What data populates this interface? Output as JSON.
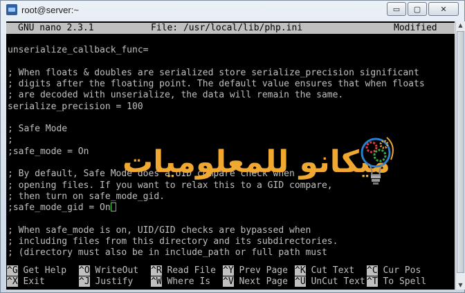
{
  "window": {
    "title": "root@server:~",
    "buttons": {
      "minimize": "▭",
      "maximize": "▢",
      "close": "✕"
    }
  },
  "nano": {
    "version": "GNU nano 2.3.1",
    "file": "File: /usr/local/lib/php.ini",
    "status": "Modified"
  },
  "lines": [
    "unserialize_callback_func=",
    "",
    "; When floats & doubles are serialized store serialize_precision significant",
    "; digits after the floating point. The default value ensures that when floats",
    "; are decoded with unserialize, the data will remain the same.",
    "serialize_precision = 100",
    "",
    "; Safe Mode",
    ";",
    ";safe_mode = On",
    "",
    "; By default, Safe Mode does a UID compare check when",
    "; opening files. If you want to relax this to a GID compare,",
    "; then turn on safe_mode_gid.",
    ";safe_mode_gid = On",
    "",
    "; When safe_mode is on, UID/GID checks are bypassed when",
    "; including files from this directory and its subdirectories.",
    "; (directory must also be in include_path or full path must"
  ],
  "shortcuts": [
    [
      {
        "key": "^G",
        "desc": " Get Help"
      },
      {
        "key": "^O",
        "desc": " WriteOut"
      },
      {
        "key": "^R",
        "desc": " Read File"
      },
      {
        "key": "^Y",
        "desc": " Prev Page"
      },
      {
        "key": "^K",
        "desc": " Cut Text"
      },
      {
        "key": "^C",
        "desc": " Cur Pos"
      }
    ],
    [
      {
        "key": "^X",
        "desc": " Exit"
      },
      {
        "key": "^J",
        "desc": " Justify"
      },
      {
        "key": "^W",
        "desc": " Where Is"
      },
      {
        "key": "^V",
        "desc": " Next Page"
      },
      {
        "key": "^U",
        "desc": " UnCut Text"
      },
      {
        "key": "^T",
        "desc": " To Spell"
      }
    ]
  ],
  "watermark": {
    "text": "ميكانو للمعلوميات"
  },
  "colors": {
    "terminal_bg": "#000000",
    "terminal_fg": "#c0c0c0",
    "cursor": "#3fe03f",
    "watermark": "#f0a830"
  }
}
